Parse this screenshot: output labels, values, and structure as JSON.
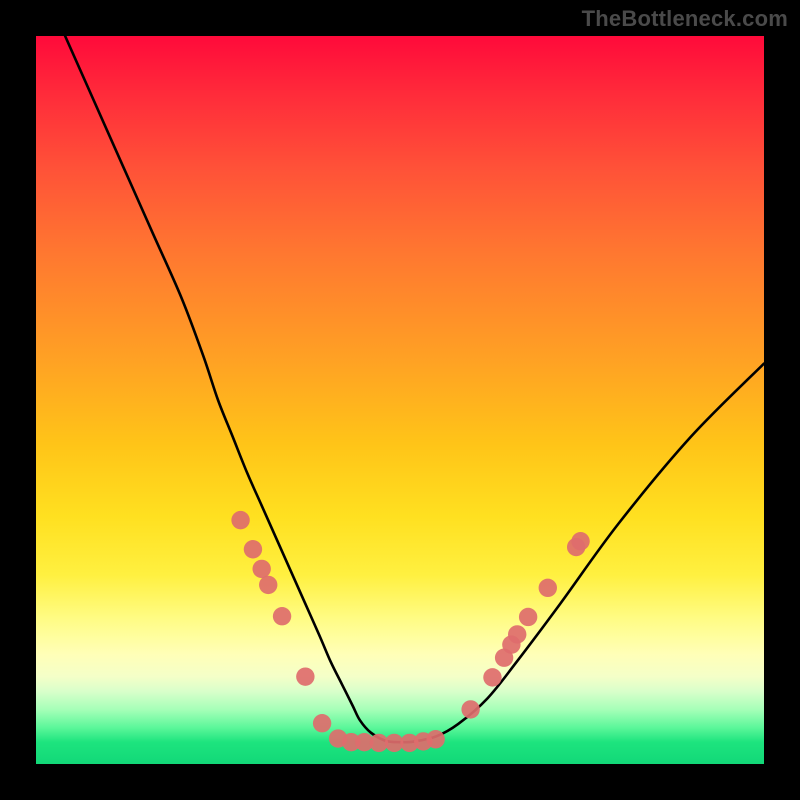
{
  "watermark": "TheBottleneck.com",
  "chart_data": {
    "type": "line",
    "title": "",
    "xlabel": "",
    "ylabel": "",
    "xlim": [
      0,
      100
    ],
    "ylim": [
      0,
      100
    ],
    "grid": false,
    "legend": false,
    "series": [
      {
        "name": "bottleneck-curve",
        "x": [
          4,
          8,
          12,
          16,
          20,
          23,
          25,
          27,
          29,
          31,
          33,
          35,
          37,
          39,
          40.5,
          42,
          43.5,
          44.5,
          46,
          48,
          50,
          52,
          55,
          58,
          62,
          66,
          72,
          80,
          90,
          100
        ],
        "values": [
          100,
          91,
          82,
          73,
          64,
          56,
          50,
          45,
          40,
          35.5,
          31,
          26.5,
          22,
          17.5,
          14,
          11,
          8,
          6,
          4.3,
          3.2,
          3.0,
          3.1,
          3.8,
          5.5,
          9,
          14,
          22,
          33,
          45,
          55
        ]
      }
    ],
    "markers": {
      "name": "dot-cluster",
      "color": "#de6d6d",
      "points": [
        {
          "x": 28.1,
          "y": 33.5
        },
        {
          "x": 29.8,
          "y": 29.5
        },
        {
          "x": 31.0,
          "y": 26.8
        },
        {
          "x": 31.9,
          "y": 24.6
        },
        {
          "x": 33.8,
          "y": 20.3
        },
        {
          "x": 37.0,
          "y": 12.0
        },
        {
          "x": 39.3,
          "y": 5.6
        },
        {
          "x": 41.5,
          "y": 3.5
        },
        {
          "x": 43.3,
          "y": 3.0
        },
        {
          "x": 45.1,
          "y": 3.0
        },
        {
          "x": 47.1,
          "y": 2.9
        },
        {
          "x": 49.2,
          "y": 2.9
        },
        {
          "x": 51.3,
          "y": 2.9
        },
        {
          "x": 53.2,
          "y": 3.1
        },
        {
          "x": 54.9,
          "y": 3.4
        },
        {
          "x": 59.7,
          "y": 7.5
        },
        {
          "x": 62.7,
          "y": 11.9
        },
        {
          "x": 64.3,
          "y": 14.6
        },
        {
          "x": 65.3,
          "y": 16.4
        },
        {
          "x": 66.1,
          "y": 17.8
        },
        {
          "x": 67.6,
          "y": 20.2
        },
        {
          "x": 70.3,
          "y": 24.2
        },
        {
          "x": 74.2,
          "y": 29.8
        },
        {
          "x": 74.8,
          "y": 30.6
        }
      ]
    },
    "background_gradient": {
      "stops": [
        {
          "pos": 0,
          "color": "#ff0a3a"
        },
        {
          "pos": 0.18,
          "color": "#ff5138"
        },
        {
          "pos": 0.44,
          "color": "#ffa024"
        },
        {
          "pos": 0.66,
          "color": "#ffe020"
        },
        {
          "pos": 0.82,
          "color": "#fffca0"
        },
        {
          "pos": 0.92,
          "color": "#a6ffb8"
        },
        {
          "pos": 1.0,
          "color": "#12d878"
        }
      ]
    }
  }
}
